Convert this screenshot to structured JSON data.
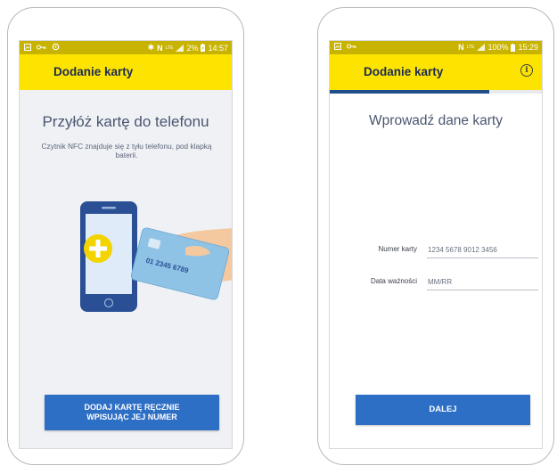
{
  "colors": {
    "accent_yellow": "#fde400",
    "status_yellow": "#c8b400",
    "primary_blue": "#2e6fc6",
    "title_navy": "#1b2a55"
  },
  "left": {
    "status_bar": {
      "icons_left": [
        "image-icon",
        "key-icon",
        "sync-icon"
      ],
      "icons_right": [
        "bluetooth-icon",
        "nfc-icon",
        "lte-icon",
        "signal-icon"
      ],
      "battery": "2%",
      "time": "14:57"
    },
    "app_bar": {
      "title": "Dodanie karty"
    },
    "headline": "Przyłóż kartę do telefonu",
    "hint": "Czytnik NFC znajduje się z tyłu telefonu, pod klapką baterii.",
    "card_number_fragment": "01 2345 6789",
    "manual_button": "DODAJ KARTĘ RĘCZNIE\nWPISUJĄC JEJ NUMER"
  },
  "right": {
    "status_bar": {
      "icons_left": [
        "image-icon",
        "key-icon"
      ],
      "icons_right": [
        "nfc-icon",
        "lte-icon",
        "signal-icon"
      ],
      "battery": "100%",
      "time": "15:29"
    },
    "app_bar": {
      "title": "Dodanie karty",
      "info_icon": "info-icon"
    },
    "progress": 0.75,
    "headline": "Wprowadź dane karty",
    "form": {
      "card_number": {
        "label": "Numer karty",
        "placeholder": "1234 5678 9012 3456"
      },
      "expiry": {
        "label": "Data ważności",
        "placeholder": "MM/RR"
      }
    },
    "next_button": "DALEJ"
  }
}
